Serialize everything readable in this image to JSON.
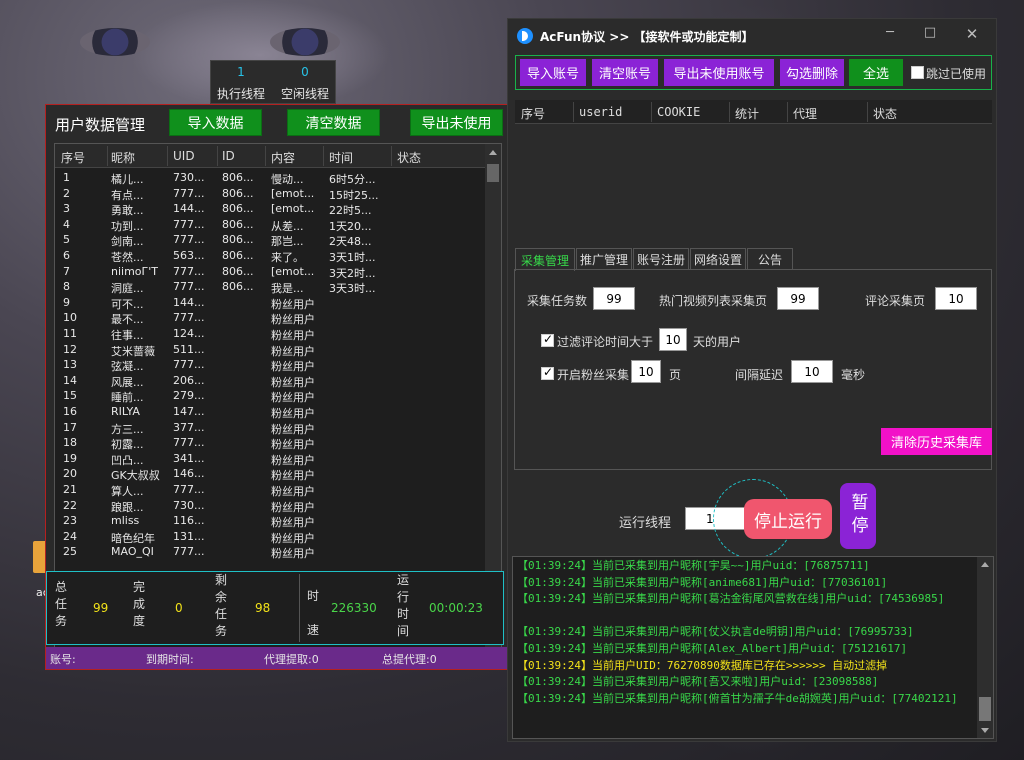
{
  "colors": {
    "accent_green": "#10901c",
    "accent_purple": "#8b23d6",
    "accent_magenta": "#f211c8",
    "stop_red": "#f0566e",
    "log_green": "#39d84a",
    "log_yellow": "#f2e21a",
    "stat_cyan": "#1fc0c6",
    "left_border_red": "#b52020"
  },
  "desktop": {
    "icon_label": "ac"
  },
  "threads": {
    "exec_count": "1",
    "exec_label": "执行线程",
    "idle_count": "0",
    "idle_label": "空闲线程"
  },
  "left": {
    "title": "用户数据管理",
    "btn_import": "导入数据",
    "btn_clear": "清空数据",
    "btn_export": "导出未使用",
    "columns": [
      "序号",
      "昵称",
      "UID",
      "ID",
      "内容",
      "时间",
      "状态"
    ],
    "rows": [
      [
        "1",
        "橘儿...",
        "730...",
        "806...",
        "慢动...",
        "6时5分..."
      ],
      [
        "2",
        "有点...",
        "777...",
        "806...",
        "[emot...",
        "15时25..."
      ],
      [
        "3",
        "勇敢...",
        "144...",
        "806...",
        "[emot...",
        "22时5..."
      ],
      [
        "4",
        "功到...",
        "777...",
        "806...",
        "从差...",
        "1天20..."
      ],
      [
        "5",
        "剑南...",
        "777...",
        "806...",
        "那岂...",
        "2天48..."
      ],
      [
        "6",
        "苍然...",
        "563...",
        "806...",
        "来了。",
        "3天1时..."
      ],
      [
        "7",
        "niimoГ'T",
        "777...",
        "806...",
        "[emot...",
        "3天2时..."
      ],
      [
        "8",
        "洞庭...",
        "777...",
        "806...",
        "我是...",
        "3天3时..."
      ],
      [
        "9",
        "可不...",
        "144...",
        "",
        "粉丝用户",
        ""
      ],
      [
        "10",
        "最不...",
        "777...",
        "",
        "粉丝用户",
        ""
      ],
      [
        "11",
        "往事...",
        "124...",
        "",
        "粉丝用户",
        ""
      ],
      [
        "12",
        "艾米蔷薇",
        "511...",
        "",
        "粉丝用户",
        ""
      ],
      [
        "13",
        "弦凝...",
        "777...",
        "",
        "粉丝用户",
        ""
      ],
      [
        "14",
        "风展...",
        "206...",
        "",
        "粉丝用户",
        ""
      ],
      [
        "15",
        "睡前...",
        "279...",
        "",
        "粉丝用户",
        ""
      ],
      [
        "16",
        "RILYA",
        "147...",
        "",
        "粉丝用户",
        ""
      ],
      [
        "17",
        "方三...",
        "377...",
        "",
        "粉丝用户",
        ""
      ],
      [
        "18",
        "初露...",
        "777...",
        "",
        "粉丝用户",
        ""
      ],
      [
        "19",
        "凹凸...",
        "341...",
        "",
        "粉丝用户",
        ""
      ],
      [
        "20",
        "GK大叔叔",
        "146...",
        "",
        "粉丝用户",
        ""
      ],
      [
        "21",
        "算人...",
        "777...",
        "",
        "粉丝用户",
        ""
      ],
      [
        "22",
        "踉跟...",
        "730...",
        "",
        "粉丝用户",
        ""
      ],
      [
        "23",
        "mliss",
        "116...",
        "",
        "粉丝用户",
        ""
      ],
      [
        "24",
        "暗色纪年",
        "131...",
        "",
        "粉丝用户",
        ""
      ],
      [
        "25",
        "MAO_QI",
        "777...",
        "",
        "粉丝用户",
        ""
      ]
    ],
    "stats": {
      "total_label": "总任务",
      "total": "99",
      "done_label": "完成度",
      "done": "0",
      "remain_label": "剩余任务",
      "remain": "98",
      "speed_label": "时速",
      "speed": "226330",
      "runtime_label": "运行时间",
      "runtime": "00:00:23"
    },
    "status_bar": {
      "account": "账号:",
      "expire": "到期时间:",
      "proxy_fetch": "代理提取:0",
      "proxy_total": "总提代理:0"
    }
  },
  "right": {
    "title": "AcFun协议 >> 【接软件或功能定制】",
    "toolbar": {
      "import": "导入账号",
      "clear": "清空账号",
      "export": "导出未使用账号",
      "delete_checked": "勾选删除",
      "select_all": "全选",
      "skip_used": "跳过已使用"
    },
    "acct_columns": [
      "序号",
      "userid",
      "COOKIE",
      "统计",
      "代理",
      "状态"
    ],
    "tabs": [
      "采集管理",
      "推广管理",
      "账号注册",
      "网络设置",
      "公告"
    ],
    "collect": {
      "task_count_label": "采集任务数",
      "task_count": "99",
      "hot_pages_label": "热门视频列表采集页",
      "hot_pages": "99",
      "comment_pages_label": "评论采集页",
      "comment_pages": "10",
      "filter_label": "过滤评论时间大于",
      "filter_days": "10",
      "filter_suffix": "天的用户",
      "fans_label": "开启粉丝采集",
      "fans_pages": "10",
      "fans_suffix": "页",
      "interval_label": "间隔延迟",
      "interval": "10",
      "interval_unit": "毫秒",
      "clear_history": "清除历史采集库"
    },
    "run": {
      "threads_label": "运行线程",
      "threads": "1",
      "stop": "停止运行",
      "pause": "暂停"
    },
    "log": [
      {
        "text": "【01:39:24】当前已采集到用户昵称[宇昊~~]用户uid：[76875711]",
        "color": "green"
      },
      {
        "text": "【01:39:24】当前已采集到用户昵称[anime681]用户uid：[77036101]",
        "color": "green"
      },
      {
        "text": "【01:39:24】当前已采集到用户昵称[葛沽金街尾风营救在线]用户uid：[74536985]",
        "color": "green"
      },
      {
        "text": "【01:39:24】当前已采集到用户昵称[仗义执言de明钥]用户uid：[76995733]",
        "color": "green"
      },
      {
        "text": "【01:39:24】当前已采集到用户昵称[Alex_Albert]用户uid：[75121617]",
        "color": "green"
      },
      {
        "text": "【01:39:24】当前用户UID：76270890数据库已存在>>>>>>  自动过滤掉",
        "color": "yellow"
      },
      {
        "text": "【01:39:24】当前已采集到用户昵称[吾又来啦]用户uid：[23098588]",
        "color": "green"
      },
      {
        "text": "【01:39:24】当前已采集到用户昵称[俯首甘为孺子牛de胡婉英]用户uid：[77402121]",
        "color": "green"
      }
    ]
  }
}
